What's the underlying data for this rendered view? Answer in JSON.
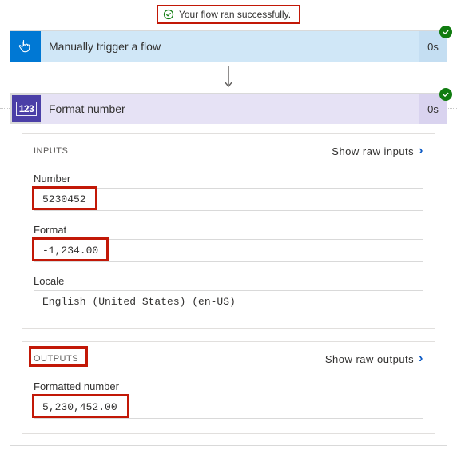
{
  "banner": {
    "message": "Your flow ran successfully."
  },
  "trigger": {
    "title": "Manually trigger a flow",
    "duration": "0s"
  },
  "action": {
    "title": "Format number",
    "duration": "0s"
  },
  "inputs": {
    "heading": "INPUTS",
    "show_raw": "Show raw inputs",
    "number": {
      "label": "Number",
      "value": "5230452"
    },
    "format": {
      "label": "Format",
      "value": "-1,234.00"
    },
    "locale": {
      "label": "Locale",
      "value": "English (United States) (en-US)"
    }
  },
  "outputs": {
    "heading": "OUTPUTS",
    "show_raw": "Show raw outputs",
    "formatted": {
      "label": "Formatted number",
      "value": "5,230,452.00"
    }
  }
}
